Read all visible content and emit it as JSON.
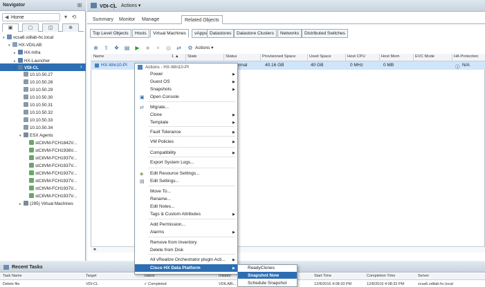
{
  "navigator": {
    "title": "Navigator",
    "breadcrumb": "Home",
    "tree": [
      {
        "label": "vcsa6.vdilab-hc.local",
        "indent": 0
      },
      {
        "label": "HX-VDILAB",
        "indent": 1
      },
      {
        "label": "HX-Infra",
        "indent": 2
      },
      {
        "label": "HX-Launcher",
        "indent": 2
      },
      {
        "label": "VDI-CL",
        "indent": 2
      },
      {
        "label": "10.10.50.27",
        "indent": 3
      },
      {
        "label": "10.10.50.28",
        "indent": 3
      },
      {
        "label": "10.10.50.29",
        "indent": 3
      },
      {
        "label": "10.10.50.30",
        "indent": 3
      },
      {
        "label": "10.10.50.31",
        "indent": 3
      },
      {
        "label": "10.10.50.32",
        "indent": 3
      },
      {
        "label": "10.10.50.33",
        "indent": 3
      },
      {
        "label": "10.10.50.34",
        "indent": 3
      },
      {
        "label": "ESX Agents",
        "indent": 3
      },
      {
        "label": "stCtlVM-FCH1842V...",
        "indent": 4
      },
      {
        "label": "stCtlVM-FCH1936V...",
        "indent": 4
      },
      {
        "label": "stCtlVM-FCH1937V...",
        "indent": 4
      },
      {
        "label": "stCtlVM-FCH1937V...",
        "indent": 4
      },
      {
        "label": "stCtlVM-FCH1937V...",
        "indent": 4
      },
      {
        "label": "stCtlVM-FCH1937V...",
        "indent": 4
      },
      {
        "label": "stCtlVM-FCH1937V...",
        "indent": 4
      },
      {
        "label": "stCtlVM-FCH1937V...",
        "indent": 4
      },
      {
        "label": "(295) Virtual Machines",
        "indent": 3
      }
    ]
  },
  "header": {
    "object": "VDI-CL",
    "actions": "Actions"
  },
  "tabs": [
    "Summary",
    "Monitor",
    "Manage",
    "Related Objects"
  ],
  "subtabs": [
    "Top Level Objects",
    "Hosts",
    "Virtual Machines",
    "vApps",
    "Datastores",
    "Datastore Clusters",
    "Networks",
    "Distributed Switches"
  ],
  "toolbar": {
    "actions": "Actions"
  },
  "grid": {
    "columns": [
      "Name",
      "1 ▲",
      "State",
      "Status",
      "Provisioned Space",
      "Used Space",
      "Host CPU",
      "Host Mem",
      "EVC Mode",
      "HA Protection"
    ],
    "row": {
      "name": "HX-Win10-PI",
      "status": "ormal",
      "provisioned": "40.16  GB",
      "used": "40  GB",
      "cpu": "0 MHz",
      "mem": "0 MB",
      "ha": "N/A"
    }
  },
  "menu": {
    "header": "Actions - HX-Win10-PI",
    "items": [
      "Power",
      "Guest OS",
      "Snapshots",
      "Open Console",
      "Migrate...",
      "Clone",
      "Template",
      "Fault Tolerance",
      "VM Policies",
      "Compatibility",
      "Export System Logs...",
      "Edit Resource Settings...",
      "Edit Settings...",
      "Move To...",
      "Rename...",
      "Edit Notes...",
      "Tags & Custom Attributes",
      "Add Permission...",
      "Alarms",
      "Remove from Inventory",
      "Delete from Disk",
      "All vRealize Orchestrator plugin Acti...",
      "Cisco HX Data Platform"
    ]
  },
  "submenu": [
    "ReadyClones",
    "Snapshot Now",
    "Schedule Snapshot"
  ],
  "tasks": {
    "title": "Recent Tasks",
    "columns": [
      "Task Name",
      "Target",
      "Status",
      "Initiator",
      "Queued For",
      "Start Time",
      "Completion Time",
      "Server"
    ],
    "row": [
      "Delete file",
      "VDI-CL",
      "✓ Completed",
      "VDILAB\\...",
      "",
      "12/8/2016 4:08:33 PM",
      "12/8/2016 4:08:33 PM",
      "vcsa6.vdilab-hc.local"
    ]
  },
  "colors": {
    "selection": "#2d6eb3",
    "highlight_row": "#cfe5fa"
  }
}
